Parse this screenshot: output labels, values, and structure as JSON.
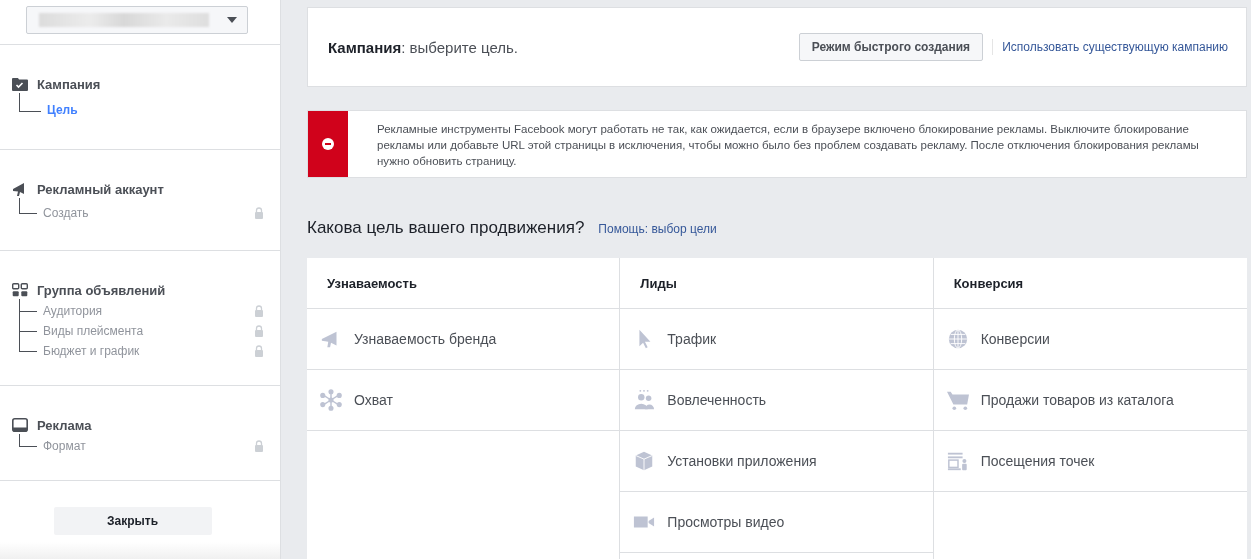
{
  "sidebar": {
    "account_dropdown": {
      "expanded": false
    },
    "sections": [
      {
        "kind": "folder",
        "title": "Кампания",
        "items": [
          {
            "label": "Цель",
            "selected": true,
            "locked": false
          }
        ]
      },
      {
        "kind": "megaphone",
        "title": "Рекламный аккаунт",
        "items": [
          {
            "label": "Создать",
            "selected": false,
            "locked": true
          }
        ]
      },
      {
        "kind": "grid",
        "title": "Группа объявлений",
        "items": [
          {
            "label": "Аудитория",
            "selected": false,
            "locked": true
          },
          {
            "label": "Виды плейсмента",
            "selected": false,
            "locked": true
          },
          {
            "label": "Бюджет и график",
            "selected": false,
            "locked": true
          }
        ]
      },
      {
        "kind": "tablet",
        "title": "Реклама",
        "items": [
          {
            "label": "Формат",
            "selected": false,
            "locked": true
          }
        ]
      }
    ],
    "close_button": "Закрыть"
  },
  "header": {
    "title": "Кампания",
    "subtitle": ": выберите цель.",
    "quick_mode_button": "Режим быстрого создания",
    "existing_link": "Использовать существующую кампанию"
  },
  "alert": {
    "text": "Рекламные инструменты Facebook могут работать не так, как ожидается, если в браузере включено блокирование рекламы. Выключите блокирование рекламы или добавьте URL этой страницы в исключения, чтобы можно было без проблем создавать рекламу. После отключения блокирования рекламы нужно обновить страницу."
  },
  "objectives": {
    "heading": "Какова цель вашего продвижения?",
    "help_link": "Помощь: выбор цели",
    "columns": [
      {
        "title": "Узнаваемость",
        "items": [
          {
            "kind": "megaphone",
            "label": "Узнаваемость бренда"
          },
          {
            "kind": "nodes",
            "label": "Охват"
          }
        ]
      },
      {
        "title": "Лиды",
        "items": [
          {
            "kind": "cursor",
            "label": "Трафик"
          },
          {
            "kind": "people",
            "label": "Вовлеченность"
          },
          {
            "kind": "cube",
            "label": "Установки приложения"
          },
          {
            "kind": "video",
            "label": "Просмотры видео"
          }
        ]
      },
      {
        "title": "Конверсия",
        "items": [
          {
            "kind": "globe",
            "label": "Конверсии"
          },
          {
            "kind": "cart",
            "label": "Продажи товаров из каталога"
          },
          {
            "kind": "store",
            "label": "Посещения точек"
          }
        ]
      }
    ]
  }
}
